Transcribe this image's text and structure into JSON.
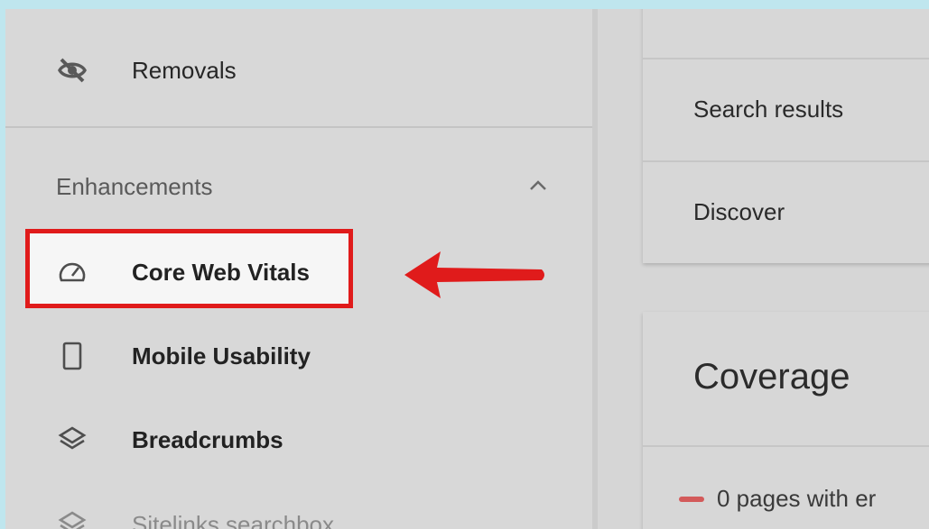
{
  "sidebar": {
    "removals_label": "Removals",
    "section_title": "Enhancements",
    "items": [
      {
        "label": "Core Web Vitals",
        "icon": "gauge-icon"
      },
      {
        "label": "Mobile Usability",
        "icon": "phone-icon"
      },
      {
        "label": "Breadcrumbs",
        "icon": "layers-icon"
      },
      {
        "label": "Sitelinks searchbox",
        "icon": "layers-icon"
      }
    ]
  },
  "performance_card": {
    "rows": [
      "Search results",
      "Discover"
    ]
  },
  "coverage_card": {
    "title": "Coverage",
    "legend": "0 pages with er"
  },
  "colors": {
    "highlight": "#e01b1b",
    "page_background": "#bfe6ee"
  }
}
